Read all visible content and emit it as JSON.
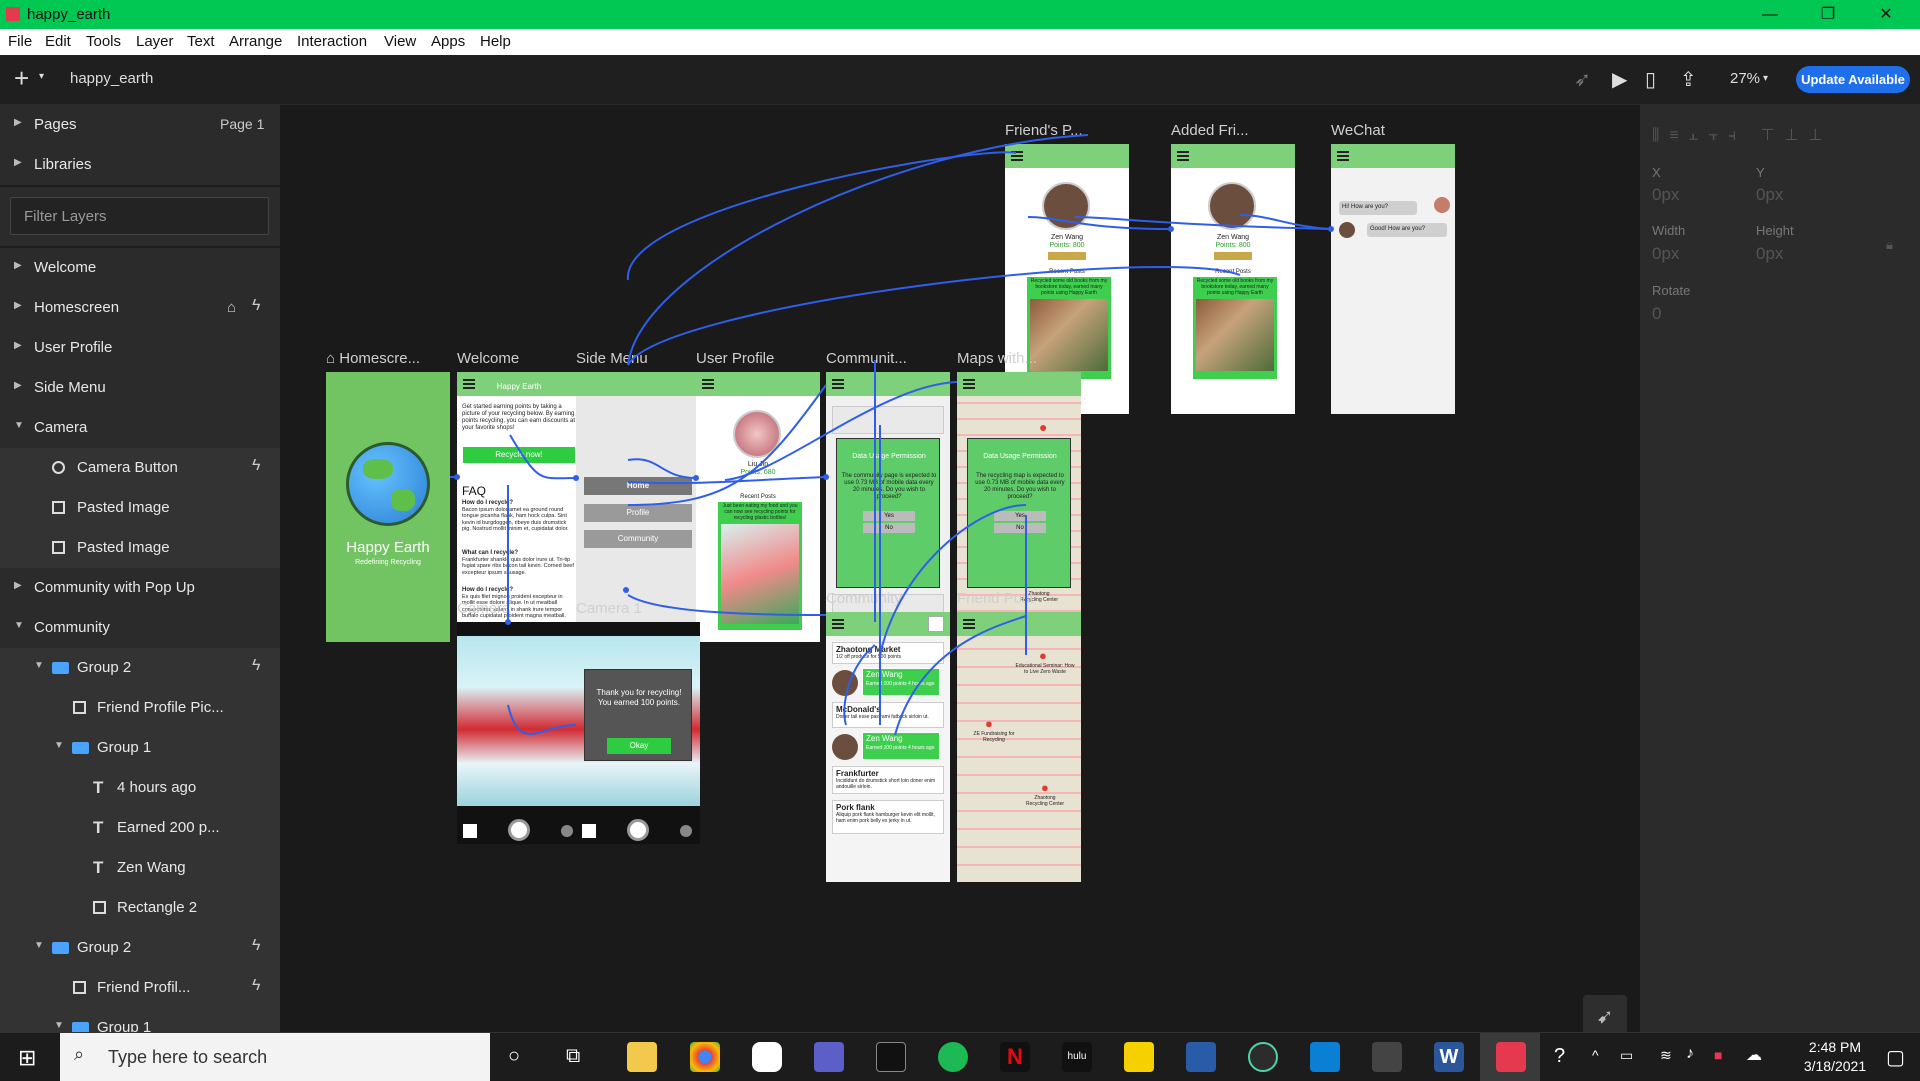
{
  "window": {
    "title": "happy_earth",
    "minimize": "—",
    "restore": "❐",
    "close": "✕"
  },
  "menu": [
    "File",
    "Edit",
    "Tools",
    "Layer",
    "Text",
    "Arrange",
    "Interaction",
    "View",
    "Apps",
    "Help"
  ],
  "toolbar": {
    "add": "+",
    "doc_name": "happy_earth",
    "zoom": "27%",
    "update": "Update Available"
  },
  "layers_panel": {
    "pages_label": "Pages",
    "page_value": "Page 1",
    "libraries": "Libraries",
    "filter_placeholder": "Filter Layers",
    "items": [
      "Welcome",
      "Homescreen",
      "User Profile",
      "Side Menu",
      "Camera",
      "Camera Button",
      "Pasted Image",
      "Pasted Image",
      "Community with Pop Up",
      "Community",
      "Group 2",
      "Friend Profile Pic...",
      "Group 1",
      "4 hours ago",
      "Earned 200 p...",
      "Zen Wang",
      "Rectangle 2",
      "Group 2",
      "Friend Profil...",
      "Group 1"
    ]
  },
  "artboards": {
    "friends_profile": "Friend's P...",
    "added_friend": "Added Fri...",
    "wechat": "WeChat",
    "homescreen": "Homescre...",
    "welcome": "Welcome",
    "side_menu": "Side Menu",
    "user_profile": "User Profile",
    "community_popup": "Communit...",
    "maps": "Maps with...",
    "camera": "Camera",
    "camera1": "Camera 1",
    "community": "Community",
    "friend_post": "Friend Post"
  },
  "screens": {
    "app_name": "Happy Earth",
    "tagline": "Redefining Recycling",
    "welcome_title": "Happy Earth",
    "welcome_text": "Get started earning points by taking a picture of your recycling below. By earning points recycling, you can earn discounts at your favorite shops!",
    "recycle_btn": "Recycle now!",
    "faq": "FAQ",
    "faq_q1": "How do I recycle?",
    "faq_a1": "Bacon ipsum dolor amet ea ground round tongue picanha flank, ham hock culpa. Sint kevin id burgdoggen, ribeye duis drumstick pig. Nostrud mollit minim et, cupidatat dolor.",
    "faq_q2": "What can I recycle?",
    "faq_a2": "Frankfurter shankle quis dolor irure ut. Tri-tip fugiat spare ribs bacon tail kevin. Corned beef excepteur ipsum sausage.",
    "faq_q3": "How do I recycle?",
    "faq_a3": "Ex quis filet mignon proident excepteur in mollit esse dolore alique. In ut meatball consectetur, salami in shank irure tempor buffalo cupidatat proident magna meatball.",
    "menu_home": "Home",
    "menu_profile": "Profile",
    "menu_community": "Community",
    "profile_name": "Liu Jin",
    "profile_points": "Points: 680",
    "recent_posts": "Recent Posts",
    "profile_post": "Just been eating my food and you can now see recycling points for recycling plastic bottles!",
    "friend_name": "Zen Wang",
    "friend_points": "Points: 800",
    "friend_recent": "Recent Posts",
    "friend_post": "Recycled some old books from my bookstore today, earned many points using Happy Earth",
    "chat1": "Hi! How are you?",
    "chat2": "Good! How are you?",
    "permission_title": "Data Usage Permission",
    "permission_text1": "The community page is expected to use 0.73 MB of mobile data every 20 minutes. Do you wish to proceed?",
    "permission_text2": "The recycling map is expected to use 0.73 MB of mobile data every 20 minutes. Do you wish to proceed?",
    "yes": "Yes",
    "no": "No",
    "thanks": "Thank you for recycling! You earned 100 points.",
    "okay": "Okay",
    "c_market": "Zhaotong Market",
    "c_market_sub": "1/2 off produce for 500 points",
    "c_user": "Zen Wang",
    "c_user_sub1": "Earned 200 points 4 hours ago",
    "c_user_sub2": "Earned 200 points 4 hours ago",
    "c_mcd": "McDonald's",
    "c_mcd_sub": "Doner tail esse pastrami fatback sirloin ut.",
    "c_frank": "Frankfurter",
    "c_frank_sub": "Incididunt do drumstick short loin doner enim andouille sirloin.",
    "c_pork": "Pork flank",
    "c_pork_sub": "Aliquip pork flank hamburger kevin elit mollit, ham enim pork belly ex jerky in ut.",
    "map_pin1": "Zhaotong Recycling Center",
    "map_pin2": "Educational Seminar: How to Live Zero Waste",
    "map_pin3": "ZE Fundraising for Recycling",
    "map_pin4": "Zhaotong Recycling Center"
  },
  "right_panel": {
    "x_label": "X",
    "x_val": "0px",
    "y_label": "Y",
    "y_val": "0px",
    "w_label": "Width",
    "w_val": "0px",
    "h_label": "Height",
    "h_val": "0px",
    "rot_label": "Rotate",
    "rot_val": "0"
  },
  "taskbar": {
    "search_placeholder": "Type here to search",
    "time": "2:48 PM",
    "date": "3/18/2021"
  }
}
